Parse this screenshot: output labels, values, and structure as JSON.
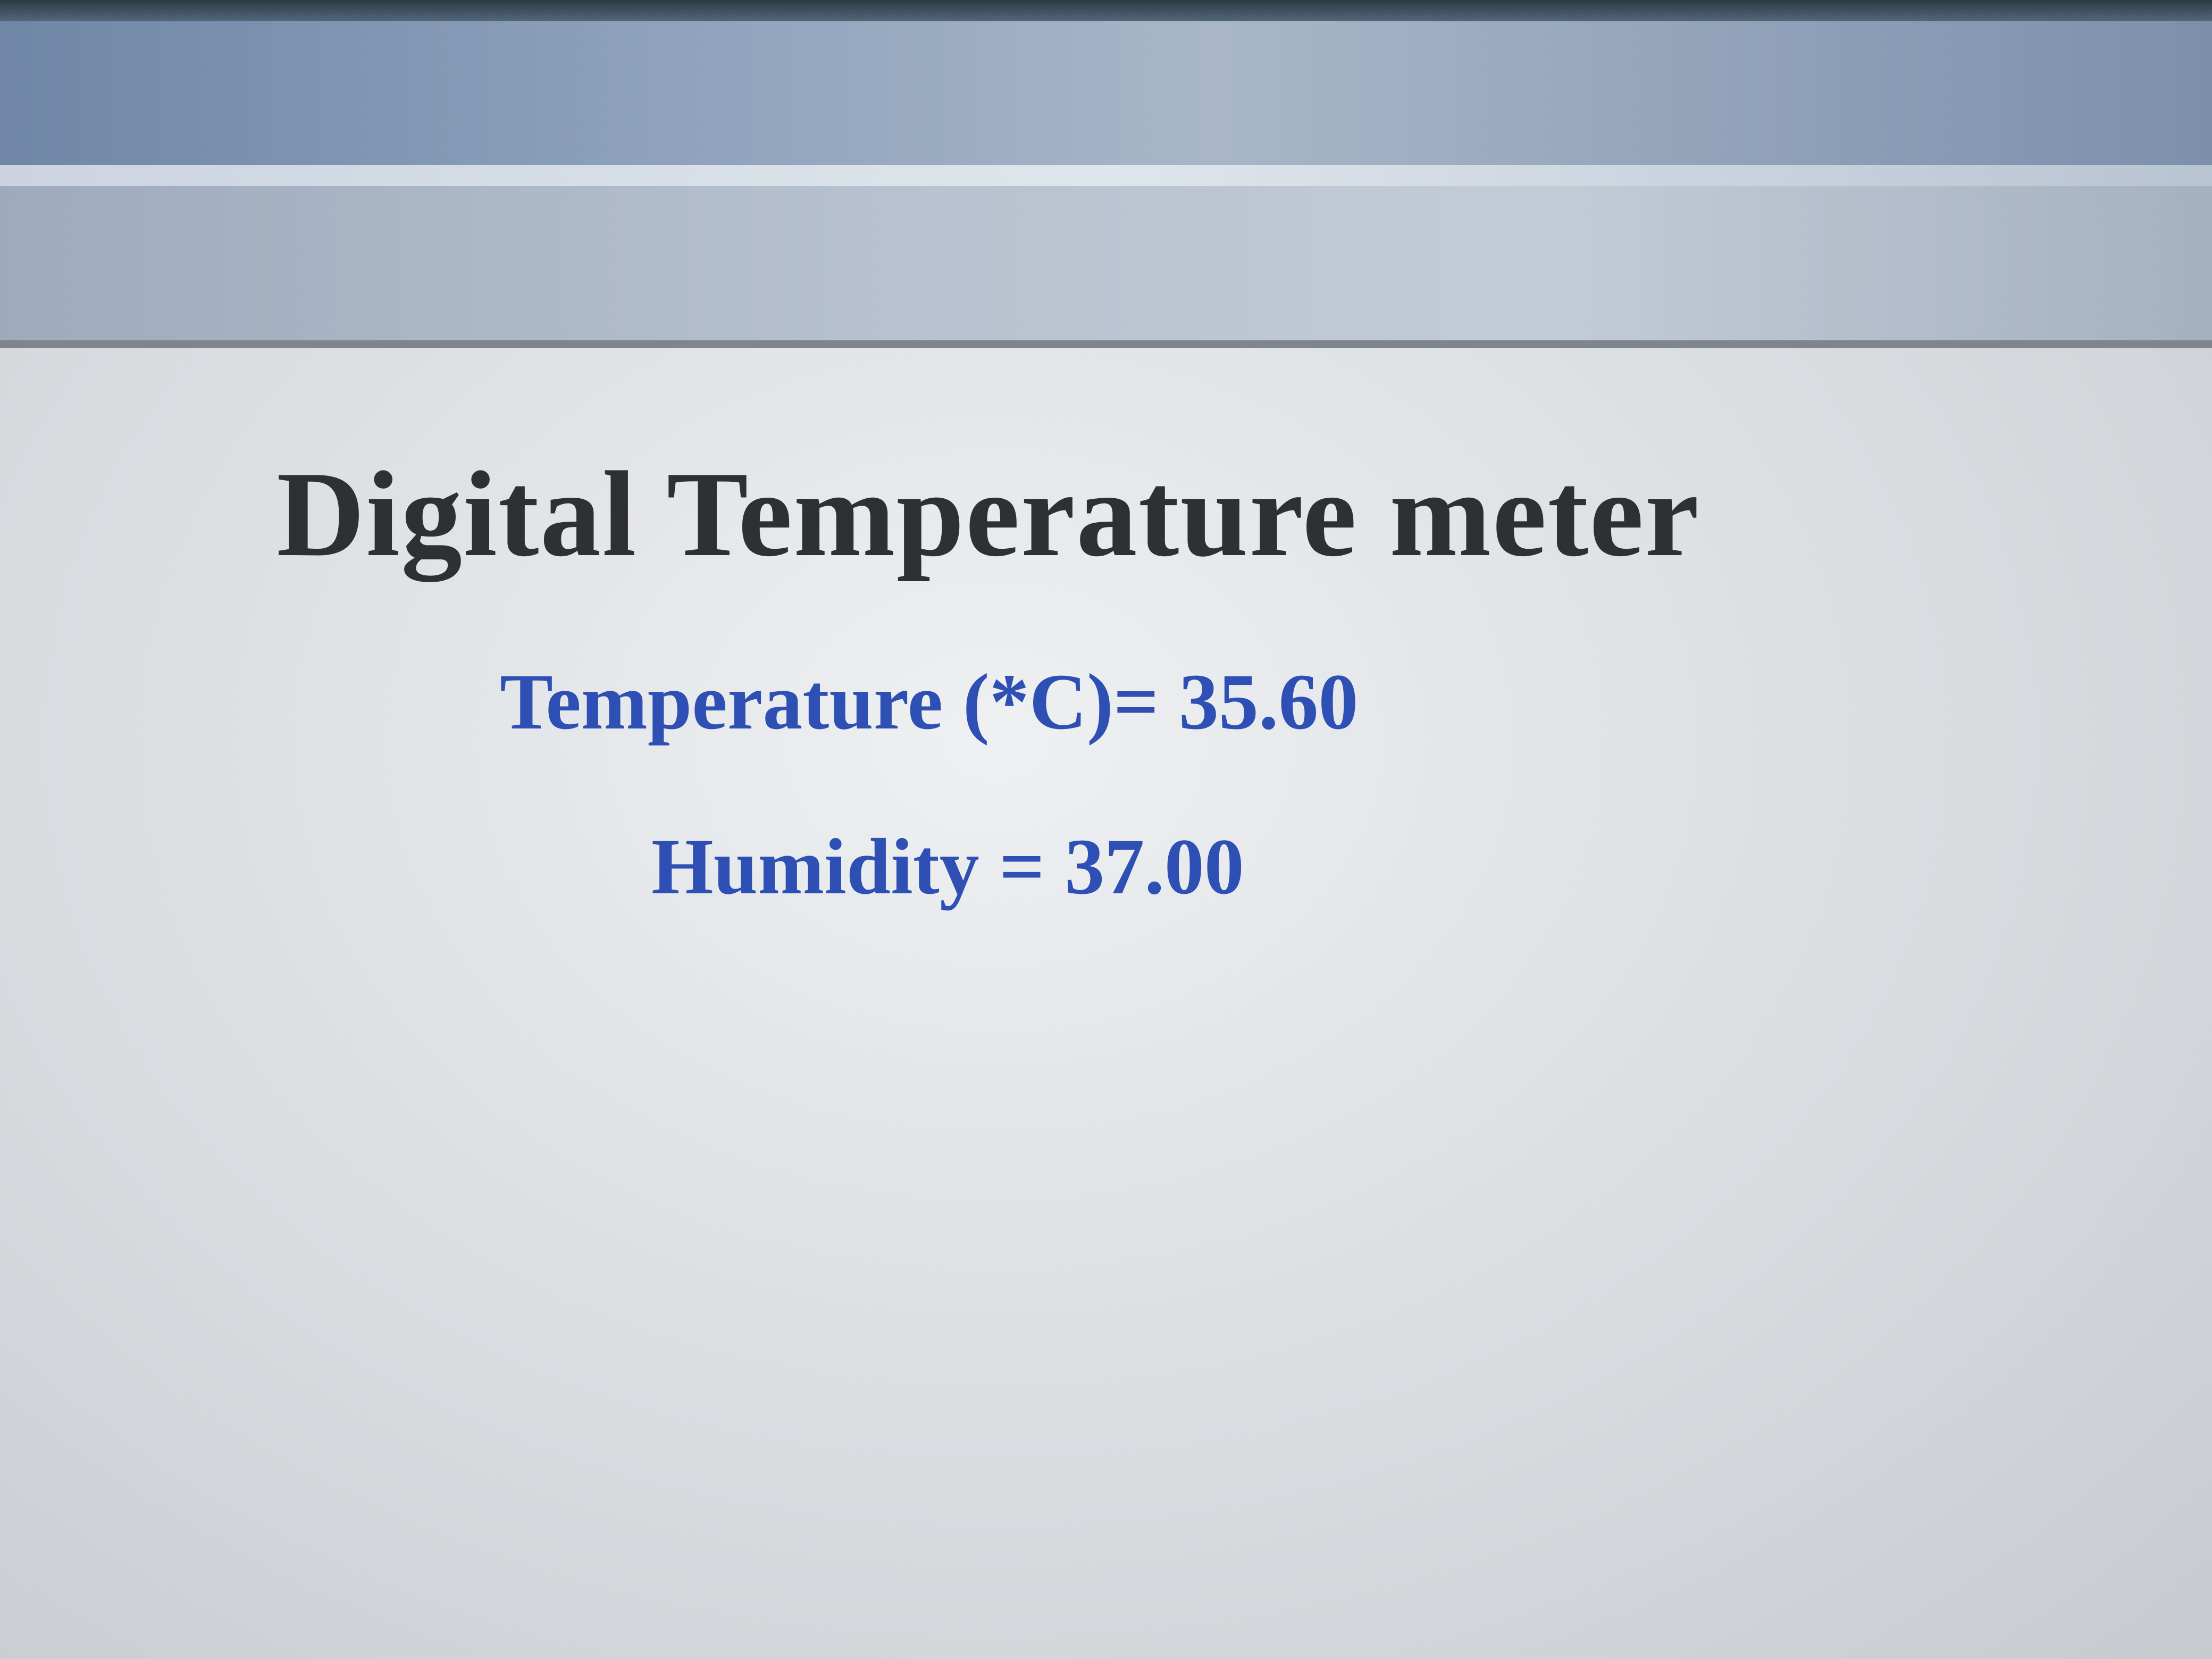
{
  "page": {
    "title": "Digital Temperature meter",
    "temperature_text": "Temperature (*C)= 35.60",
    "humidity_text": "Humidity = 37.00"
  },
  "readings": {
    "temperature_celsius": 35.6,
    "humidity": 37.0
  },
  "colors": {
    "title": "#2f3034",
    "reading_text": "#2e4fb3",
    "page_background": "#e3e5e8"
  }
}
